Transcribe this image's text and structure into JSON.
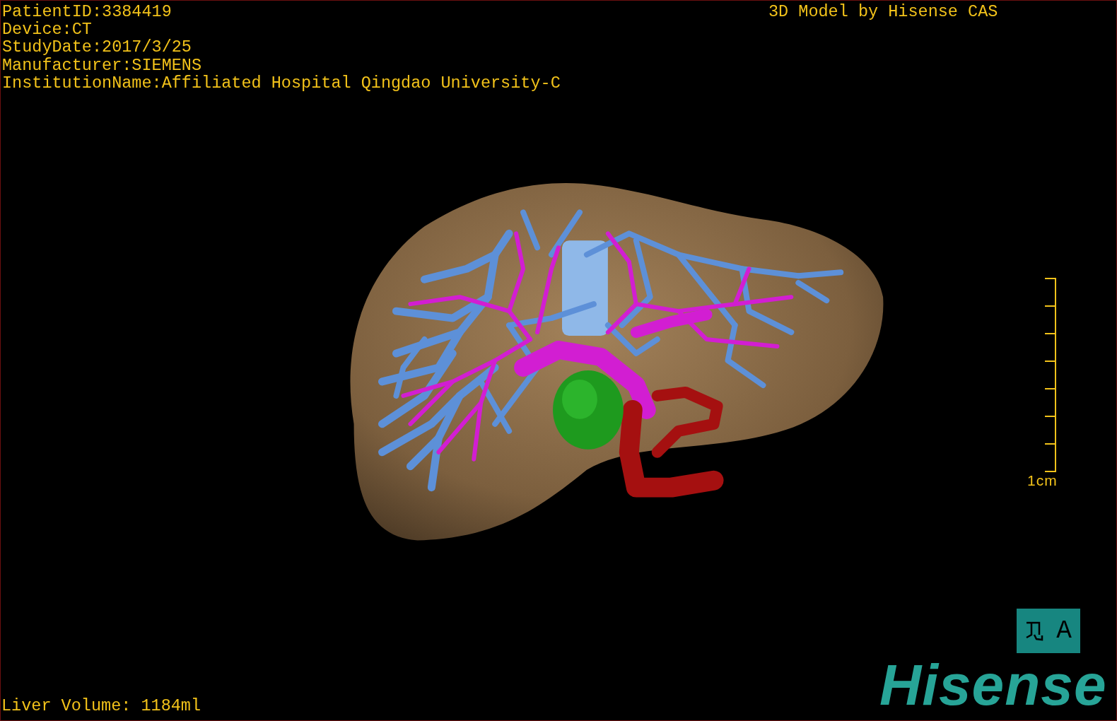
{
  "header": {
    "lines": [
      "PatientID:3384419",
      "Device:CT",
      "StudyDate:2017/3/25",
      "Manufacturer:SIEMENS",
      "InstitutionName:Affiliated Hospital Qingdao University-C"
    ]
  },
  "title": "3D Model by Hisense CAS",
  "scale_bar": {
    "label": "1cm"
  },
  "orientation": {
    "label": "A"
  },
  "liver_volume": "Liver Volume: 1184ml",
  "logo": "Hisense"
}
